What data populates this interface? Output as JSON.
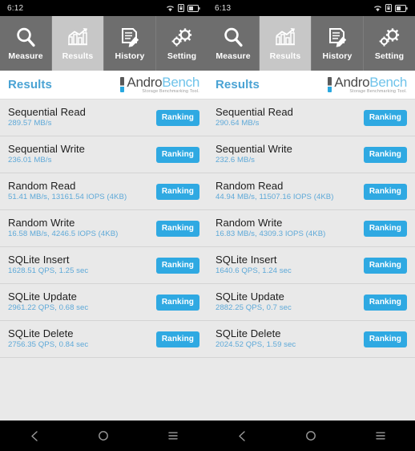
{
  "panels": [
    {
      "status": {
        "time": "6:12",
        "icons": [
          "wifi-icon",
          "sim-lock-icon",
          "battery-icon"
        ]
      },
      "tabs": [
        {
          "label": "Measure",
          "icon": "magnifier-icon",
          "active": false
        },
        {
          "label": "Results",
          "icon": "bar-chart-icon",
          "active": true
        },
        {
          "label": "History",
          "icon": "document-pencil-icon",
          "active": false
        },
        {
          "label": "Setting",
          "icon": "gears-icon",
          "active": false
        }
      ],
      "header": {
        "title": "Results",
        "logo_andro": "Andro",
        "logo_bench": "Bench",
        "logo_tagline": "Storage Benchmarking Tool."
      },
      "rows": [
        {
          "title": "Sequential Read",
          "value": "289.57 MB/s",
          "button": "Ranking"
        },
        {
          "title": "Sequential Write",
          "value": "236.01 MB/s",
          "button": "Ranking"
        },
        {
          "title": "Random Read",
          "value": "51.41 MB/s, 13161.54 IOPS (4KB)",
          "button": "Ranking"
        },
        {
          "title": "Random Write",
          "value": "16.58 MB/s, 4246.5 IOPS (4KB)",
          "button": "Ranking"
        },
        {
          "title": "SQLite Insert",
          "value": "1628.51 QPS, 1.25 sec",
          "button": "Ranking"
        },
        {
          "title": "SQLite Update",
          "value": "2961.22 QPS, 0.68 sec",
          "button": "Ranking"
        },
        {
          "title": "SQLite Delete",
          "value": "2756.35 QPS, 0.84 sec",
          "button": "Ranking"
        }
      ],
      "navbar": [
        {
          "icon": "back-icon"
        },
        {
          "icon": "home-icon"
        },
        {
          "icon": "recents-icon"
        }
      ]
    },
    {
      "status": {
        "time": "6:13",
        "icons": [
          "wifi-icon",
          "sim-lock-icon",
          "battery-icon"
        ]
      },
      "tabs": [
        {
          "label": "Measure",
          "icon": "magnifier-icon",
          "active": false
        },
        {
          "label": "Results",
          "icon": "bar-chart-icon",
          "active": true
        },
        {
          "label": "History",
          "icon": "document-pencil-icon",
          "active": false
        },
        {
          "label": "Setting",
          "icon": "gears-icon",
          "active": false
        }
      ],
      "header": {
        "title": "Results",
        "logo_andro": "Andro",
        "logo_bench": "Bench",
        "logo_tagline": "Storage Benchmarking Tool."
      },
      "rows": [
        {
          "title": "Sequential Read",
          "value": "290.64 MB/s",
          "button": "Ranking"
        },
        {
          "title": "Sequential Write",
          "value": "232.6 MB/s",
          "button": "Ranking"
        },
        {
          "title": "Random Read",
          "value": "44.94 MB/s, 11507.16 IOPS (4KB)",
          "button": "Ranking"
        },
        {
          "title": "Random Write",
          "value": "16.83 MB/s, 4309.3 IOPS (4KB)",
          "button": "Ranking"
        },
        {
          "title": "SQLite Insert",
          "value": "1640.6 QPS, 1.24 sec",
          "button": "Ranking"
        },
        {
          "title": "SQLite Update",
          "value": "2882.25 QPS, 0.7 sec",
          "button": "Ranking"
        },
        {
          "title": "SQLite Delete",
          "value": "2024.52 QPS, 1.59 sec",
          "button": "Ranking"
        }
      ],
      "navbar": [
        {
          "icon": "back-icon"
        },
        {
          "icon": "home-icon"
        },
        {
          "icon": "recents-icon"
        }
      ]
    }
  ],
  "colors": {
    "accent_blue": "#2fa9e2",
    "value_blue": "#5ea9d8",
    "header_blue": "#4aa3d4",
    "tabbar_gray": "#6e6e6e",
    "tab_active_gray": "#c7c7c7",
    "list_bg": "#e9e9e9",
    "statusbar_black": "#000000"
  }
}
